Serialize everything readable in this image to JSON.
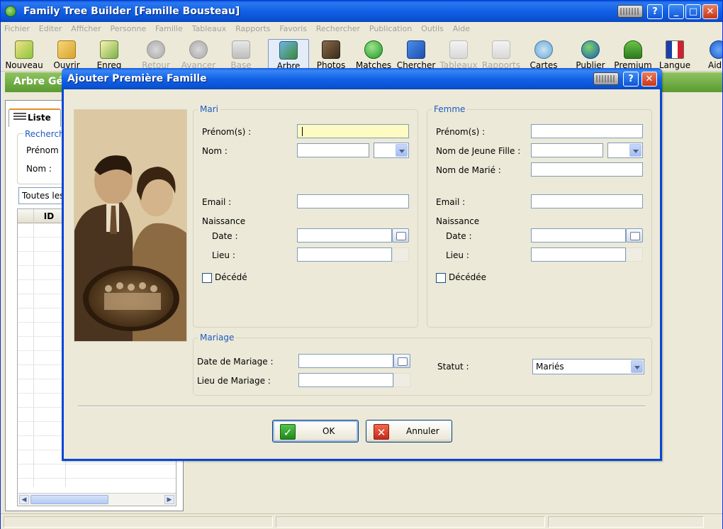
{
  "app": {
    "title": "Family Tree Builder [Famille Bousteau]"
  },
  "menu": [
    "Fichier",
    "Editer",
    "Afficher",
    "Personne",
    "Famille",
    "Tableaux",
    "Rapports",
    "Favoris",
    "Rechercher",
    "Publication",
    "Outils",
    "Aide"
  ],
  "toolbar": {
    "nouveau": "Nouveau",
    "ouvrir": "Ouvrir",
    "enreg": "Enreg",
    "retour": "Retour",
    "avancer": "Avancer",
    "base": "Base",
    "arbre": "Arbre",
    "photos": "Photos",
    "matches": "Matches",
    "chercher": "Chercher",
    "tableaux": "Tableaux",
    "rapports": "Rapports",
    "cartes": "Cartes",
    "publier": "Publier",
    "premium": "Premium",
    "langue": "Langue",
    "aide": "Aid"
  },
  "banner": {
    "title": "Arbre Gé"
  },
  "left_panel": {
    "tab": "Liste",
    "search_group": "Recherch",
    "prenom_label": "Prénom :",
    "nom_label": "Nom :",
    "filter_value": "Toutes les",
    "grid_column": "ID"
  },
  "dialog": {
    "title": "Ajouter Première Famille",
    "mari": {
      "legend": "Mari",
      "prenom_label": "Prénom(s) :",
      "nom_label": "Nom :",
      "email_label": "Email :",
      "naissance_label": "Naissance",
      "date_label": "Date :",
      "lieu_label": "Lieu :",
      "decede_label": "Décédé"
    },
    "femme": {
      "legend": "Femme",
      "prenom_label": "Prénom(s) :",
      "jeune_fille_label": "Nom de Jeune Fille :",
      "marie_label": "Nom de Marié :",
      "email_label": "Email :",
      "naissance_label": "Naissance",
      "date_label": "Date :",
      "lieu_label": "Lieu :",
      "decede_label": "Décédée"
    },
    "mariage": {
      "legend": "Mariage",
      "date_label": "Date de Mariage :",
      "lieu_label": "Lieu de Mariage :",
      "statut_label": "Statut :",
      "statut_value": "Mariés"
    },
    "buttons": {
      "ok": "OK",
      "annuler": "Annuler"
    }
  },
  "colors": {
    "titlebar": "#1160e6",
    "banner": "#6faa3d",
    "legend": "#1e5bbf",
    "focus_field": "#fdfbc2"
  }
}
